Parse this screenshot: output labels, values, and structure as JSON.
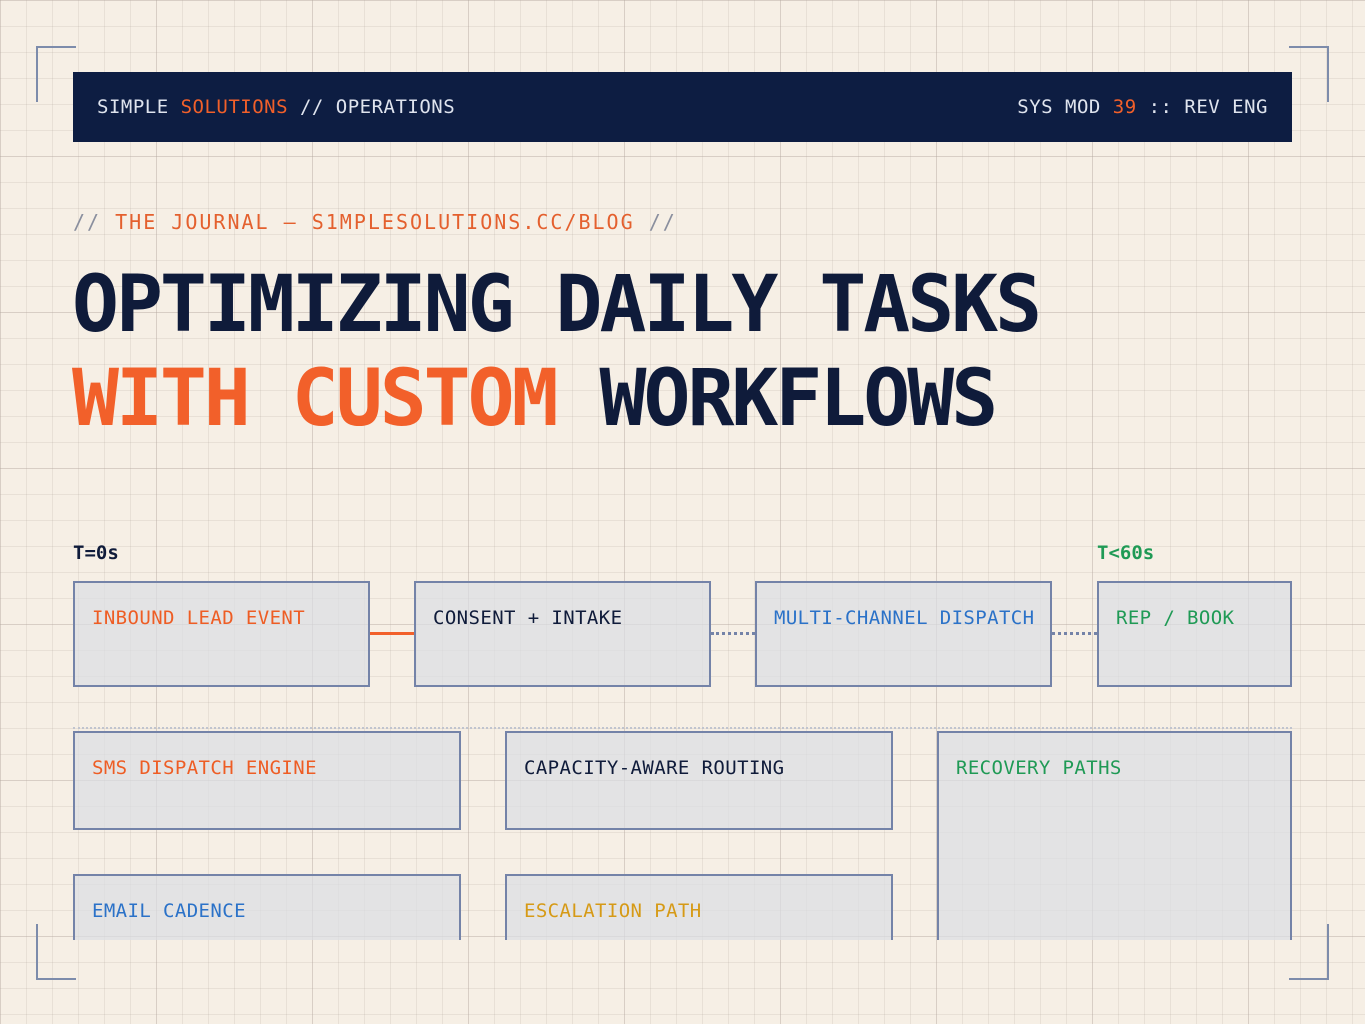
{
  "header": {
    "brand_prefix": "SIMPLE ",
    "brand_accent": "SOLUTIONS",
    "brand_suffix": " // OPERATIONS",
    "sys_prefix": "SYS MOD ",
    "sys_number": "39",
    "sys_suffix": " :: REV ENG"
  },
  "kicker": {
    "open": "// ",
    "text": "THE JOURNAL — S1MPLESOLUTIONS.CC/BLOG",
    "close": " //"
  },
  "headline": {
    "line1": "OPTIMIZING DAILY TASKS",
    "line2_accent": "WITH CUSTOM",
    "line2_rest": " WORKFLOWS"
  },
  "timeline": {
    "start_label": "T=0s",
    "end_label": "T<60s"
  },
  "flow_nodes": [
    {
      "label": "INBOUND LEAD EVENT",
      "color": "#ee5d24"
    },
    {
      "label": "CONSENT + INTAKE",
      "color": "#0f1b3a"
    },
    {
      "label": "MULTI-CHANNEL DISPATCH",
      "color": "#2b72c8"
    },
    {
      "label": "REP / BOOK",
      "color": "#1f9a55"
    }
  ],
  "modules": [
    {
      "label": "SMS DISPATCH ENGINE",
      "color": "#ee5d24"
    },
    {
      "label": "CAPACITY-AWARE ROUTING",
      "color": "#0f1b3a"
    },
    {
      "label": "RECOVERY PATHS",
      "color": "#1f9a55"
    },
    {
      "label": "EMAIL CADENCE",
      "color": "#2b72c8"
    },
    {
      "label": "ESCALATION PATH",
      "color": "#d69a16"
    }
  ],
  "colors": {
    "navy": "#0d1d42",
    "accent": "#f2602a",
    "background": "#f6efe5"
  }
}
